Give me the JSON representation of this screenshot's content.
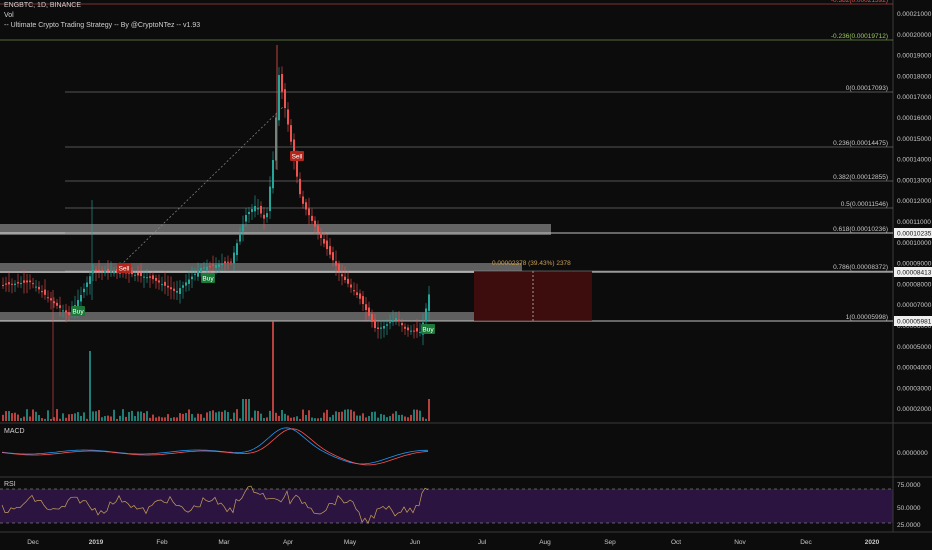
{
  "header": {
    "symbol_line": "ENGBTC, 1D, BINANCE",
    "vol_label": "Vol",
    "strategy_label": "-- Ultimate Crypto Trading Strategy -- By @CryptoNTez -- v1.93"
  },
  "panels": {
    "macd_label": "MACD",
    "rsi_label": "RSI"
  },
  "colors": {
    "background": "#0c0c0c",
    "up": "#26a69a",
    "down": "#ef5350",
    "fib_line": "#9e9e9e",
    "zone_fill": "#6e6e6e",
    "macd_line": "#2196f3",
    "signal_line": "#ff5252",
    "rsi_line": "#c9a15a",
    "rsi_band": "#2b1540",
    "profit_box": "#3d0c0c",
    "buy_badge": "#1b7a3a",
    "sell_badge": "#b3261e"
  },
  "price_axis": {
    "ticks": [
      "0.00021000",
      "0.00020000",
      "0.00019000",
      "0.00018000",
      "0.00017000",
      "0.00016000",
      "0.00015000",
      "0.00014000",
      "0.00013000",
      "0.00012000",
      "0.00011000",
      "0.00010000",
      "0.00009000",
      "0.00008000",
      "0.00007000",
      "0.00006000",
      "0.00005000",
      "0.00004000",
      "0.00003000",
      "0.00002000"
    ],
    "current_labels": [
      "0.00010235",
      "0.00008413",
      "0.00005981"
    ]
  },
  "macd_axis": {
    "ticks": [
      "0.0000000"
    ]
  },
  "rsi_axis": {
    "ticks": [
      "75.0000",
      "50.0000",
      "25.0000"
    ]
  },
  "time_axis": {
    "ticks": [
      "Dec",
      "2019",
      "Feb",
      "Mar",
      "Apr",
      "May",
      "Jun",
      "Jul",
      "Aug",
      "Sep",
      "Oct",
      "Nov",
      "Dec",
      "2020"
    ]
  },
  "fib_levels": [
    {
      "label": "-0.382(0.00021392)",
      "color": "#ef5350"
    },
    {
      "label": "-0.236(0.00019712)",
      "color": "#9ccc65"
    },
    {
      "label": "0(0.00017093)",
      "color": "#c8c8c8"
    },
    {
      "label": "0.236(0.00014475)",
      "color": "#c8c8c8"
    },
    {
      "label": "0.382(0.00012855)",
      "color": "#c8c8c8"
    },
    {
      "label": "0.5(0.00011546)",
      "color": "#c8c8c8"
    },
    {
      "label": "0.618(0.00010236)",
      "color": "#c8c8c8"
    },
    {
      "label": "0.786(0.00008372)",
      "color": "#c8c8c8"
    },
    {
      "label": "1(0.00005998)",
      "color": "#c8c8c8"
    }
  ],
  "measure_label": "0.00002378 (39.43%) 2378",
  "signals": [
    {
      "type": "sell",
      "text": "Sell"
    },
    {
      "type": "sell",
      "text": "Sell"
    },
    {
      "type": "buy",
      "text": "Buy"
    },
    {
      "type": "buy",
      "text": "Buy"
    },
    {
      "type": "buy",
      "text": "Buy"
    }
  ]
}
